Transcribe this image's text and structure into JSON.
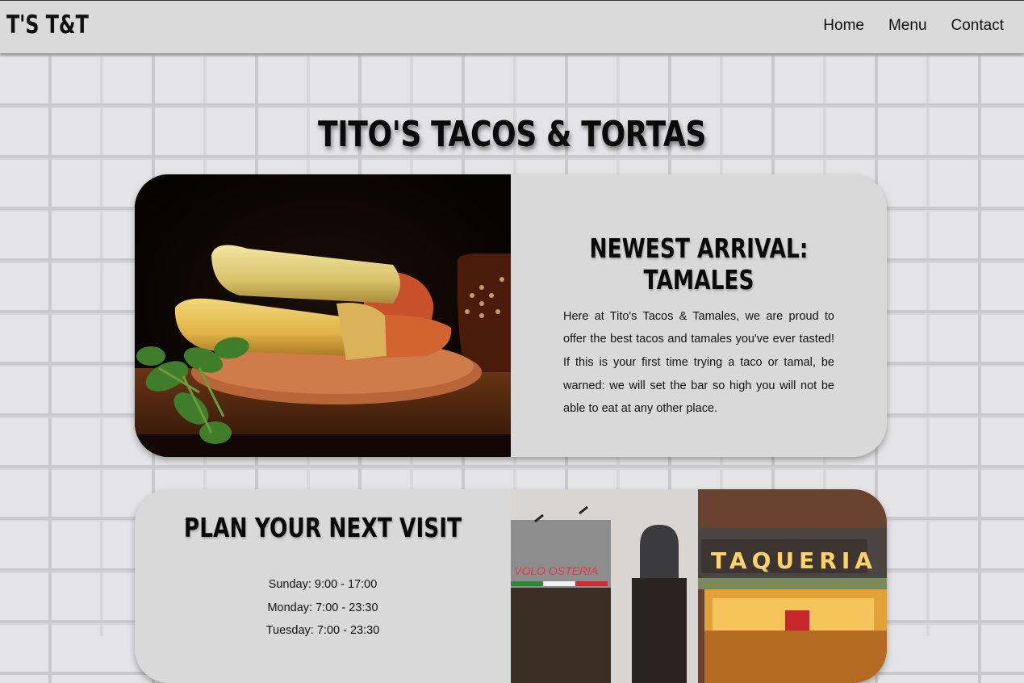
{
  "navbar": {
    "brand": "T'S T&T",
    "links": [
      "Home",
      "Menu",
      "Contact"
    ]
  },
  "page_title": "TITO'S TACOS & TORTAS",
  "feature": {
    "heading": "NEWEST ARRIVAL: TAMALES",
    "body": "Here at Tito's Tacos & Tamales, we are proud to offer the best tacos and tamales you've ever tasted! If this is your first time trying a taco or tamal, be warned: we will set the bar so high you will not be able to eat at any other place.",
    "image": "tamales-photo"
  },
  "visit": {
    "heading": "PLAN YOUR NEXT VISIT",
    "hours": [
      "Sunday: 9:00 - 17:00",
      "Monday: 7:00 - 23:30",
      "Tuesday: 7:00 - 23:30"
    ],
    "image": "taqueria-storefront-photo",
    "sign_text": "TAQUERIA",
    "neighbor_sign": "VOLO OSTERIA"
  },
  "colors": {
    "brick_background": "#e4e4e6",
    "navbar": "#dadada",
    "card": "#d9d9d9",
    "text": "#111111"
  }
}
